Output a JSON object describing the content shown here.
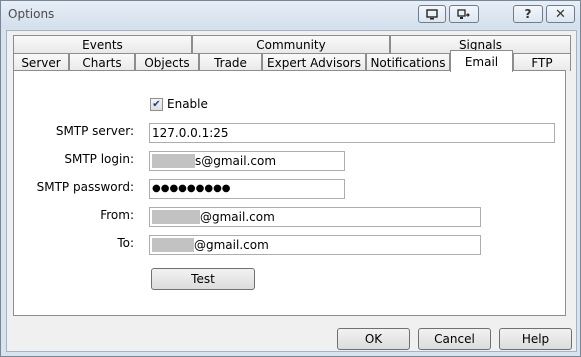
{
  "window": {
    "title": "Options"
  },
  "tabs_row1": [
    "Events",
    "Community",
    "Signals"
  ],
  "tabs_row2": [
    "Server",
    "Charts",
    "Objects",
    "Trade",
    "Expert Advisors",
    "Notifications",
    "Email",
    "FTP"
  ],
  "active_tab": "Email",
  "email": {
    "enable_label": "Enable",
    "enable_checked": true,
    "smtp_server_label": "SMTP server:",
    "smtp_server_value": "127.0.0.1:25",
    "smtp_login_label": "SMTP login:",
    "smtp_login_value": "s@gmail.com",
    "smtp_password_label": "SMTP password:",
    "smtp_password_value": "●●●●●●●●●",
    "from_label": "From:",
    "from_value": "@gmail.com",
    "to_label": "To:",
    "to_value": "@gmail.com",
    "test_button": "Test"
  },
  "footer": {
    "ok": "OK",
    "cancel": "Cancel",
    "help": "Help"
  }
}
